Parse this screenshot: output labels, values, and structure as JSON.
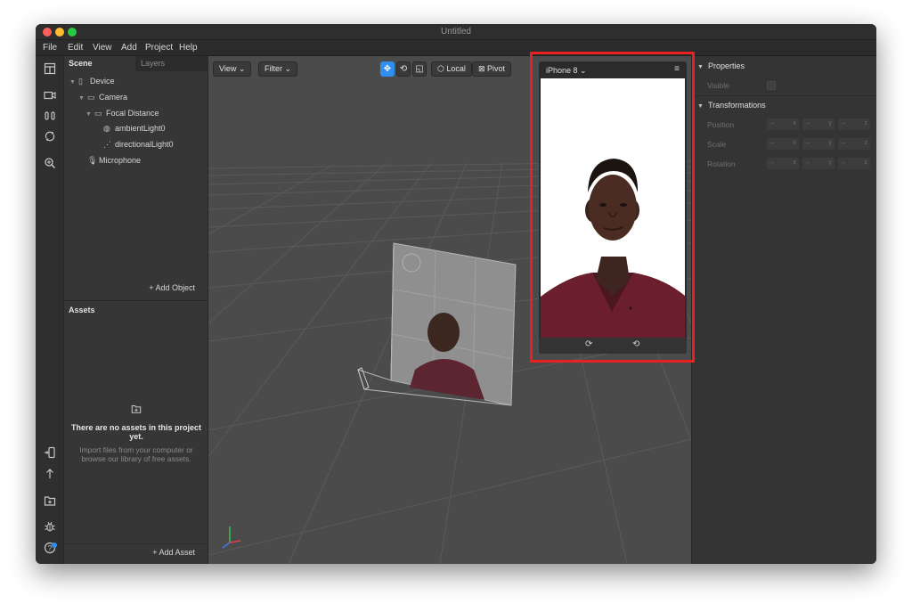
{
  "window": {
    "title": "Untitled"
  },
  "menu": [
    "File",
    "Edit",
    "View",
    "Add",
    "Project",
    "Help"
  ],
  "toolbar_icons": [
    "layout-icon",
    "video-icon",
    "record-icon",
    "sync-icon",
    "zoom-icon"
  ],
  "bottom_icons": [
    "device-add-icon",
    "upload-icon",
    "folder-add-icon",
    "bug-icon",
    "help-icon"
  ],
  "scene": {
    "tabs": [
      "Scene",
      "Layers"
    ],
    "tree": [
      {
        "label": "Device",
        "icon": "device-icon",
        "level": 0,
        "expanded": true
      },
      {
        "label": "Camera",
        "icon": "camera-icon",
        "level": 1,
        "expanded": true
      },
      {
        "label": "Focal Distance",
        "icon": "focal-icon",
        "level": 2,
        "expanded": true
      },
      {
        "label": "ambientLight0",
        "icon": "ambient-light-icon",
        "level": 3,
        "expanded": false
      },
      {
        "label": "directionalLight0",
        "icon": "directional-light-icon",
        "level": 3,
        "expanded": false
      },
      {
        "label": "Microphone",
        "icon": "microphone-icon",
        "level": 1,
        "expanded": false
      }
    ],
    "add_object": "+  Add Object"
  },
  "assets": {
    "title": "Assets",
    "empty_title": "There are no assets in this project yet.",
    "empty_sub": "Import files from your computer or browse our library of free assets.",
    "add_asset": "+  Add Asset"
  },
  "viewport": {
    "view_label": "View  ⌄",
    "filter_label": "Filter  ⌄",
    "local_label": "Local",
    "pivot_label": "Pivot"
  },
  "simulator": {
    "device": "iPhone 8  ⌄"
  },
  "properties": {
    "title": "Properties",
    "visible_label": "Visible",
    "transformations_title": "Transformations",
    "rows": [
      "Position",
      "Scale",
      "Rotation"
    ],
    "axes": [
      "x",
      "y",
      "z"
    ]
  },
  "colors": {
    "accent": "#2f8ff0",
    "highlight": "#e8201f",
    "shirt": "#6b1e2b",
    "skin": "#4a2c22"
  }
}
